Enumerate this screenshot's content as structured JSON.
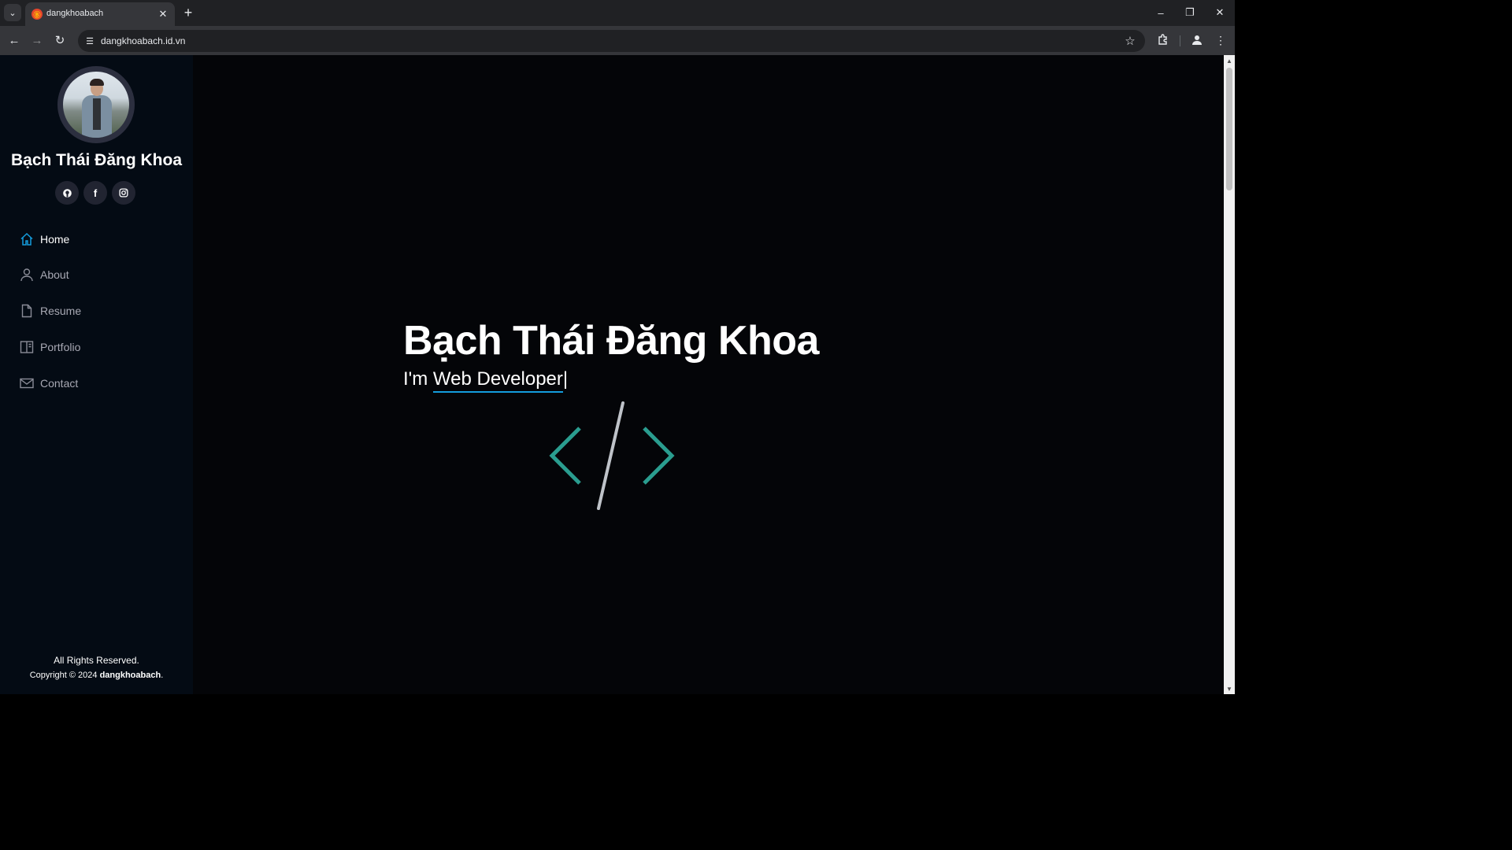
{
  "browser": {
    "tab_title": "dangkhoabach",
    "favicon_glyph": "Ⓑ",
    "url": "dangkhoabach.id.vn",
    "icons": {
      "tab_list": "chevron-down-icon",
      "tab_close": "close-icon",
      "new_tab": "plus-icon",
      "back": "arrow-left-icon",
      "forward": "arrow-right-icon",
      "reload": "reload-icon",
      "site_info": "tune-icon",
      "bookmark": "star-icon",
      "extensions": "puzzle-icon",
      "profile": "person-icon",
      "menu": "kebab-icon",
      "minimize": "minimize-icon",
      "restore": "restore-icon",
      "close": "close-icon"
    }
  },
  "sidebar": {
    "name": "Bạch Thái Đăng Khoa",
    "social": [
      {
        "name": "github-icon",
        "glyph": "◉"
      },
      {
        "name": "facebook-icon",
        "glyph": "f"
      },
      {
        "name": "instagram-icon",
        "glyph": "▣"
      }
    ],
    "nav": [
      {
        "label": "Home",
        "icon": "home-icon",
        "active": true
      },
      {
        "label": "About",
        "icon": "person-icon",
        "active": false
      },
      {
        "label": "Resume",
        "icon": "file-icon",
        "active": false
      },
      {
        "label": "Portfolio",
        "icon": "book-icon",
        "active": false
      },
      {
        "label": "Contact",
        "icon": "envelope-icon",
        "active": false
      }
    ],
    "footer": {
      "rights": "All Rights Reserved.",
      "copyright_prefix": "Copyright © 2024 ",
      "copyright_owner": "dangkhoabach",
      "copyright_suffix": "."
    }
  },
  "hero": {
    "title": "Bạch Thái Đăng Khoa",
    "subtitle_prefix": "I'm ",
    "subtitle_typed": "Web Developer",
    "cursor": "|"
  },
  "colors": {
    "accent": "#149ddd",
    "sidebar_bg": "#040b14",
    "page_bg": "#040508",
    "logo_teal": "#2a9d8f"
  }
}
